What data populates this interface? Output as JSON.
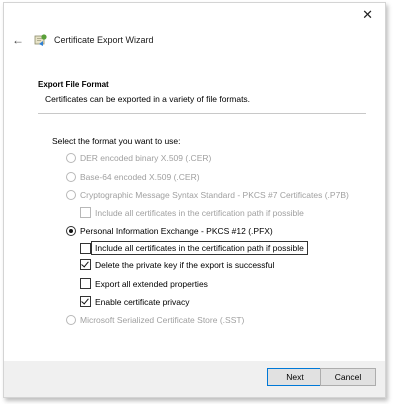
{
  "window": {
    "close_icon": "close-icon",
    "back_icon": "back-arrow-icon",
    "title_icon": "certificate-wizard-icon",
    "title": "Certificate Export Wizard"
  },
  "header": {
    "title": "Export File Format",
    "subtitle": "Certificates can be exported in a variety of file formats."
  },
  "prompt": "Select the format you want to use:",
  "formats": [
    {
      "label": "DER encoded binary X.509 (.CER)",
      "selected": false,
      "enabled": false
    },
    {
      "label": "Base-64 encoded X.509 (.CER)",
      "selected": false,
      "enabled": false
    },
    {
      "label": "Cryptographic Message Syntax Standard - PKCS #7 Certificates (.P7B)",
      "selected": false,
      "enabled": false
    },
    {
      "label": "Personal Information Exchange - PKCS #12 (.PFX)",
      "selected": true,
      "enabled": true
    },
    {
      "label": "Microsoft Serialized Certificate Store (.SST)",
      "selected": false,
      "enabled": false
    }
  ],
  "p7b_options": {
    "include_path": {
      "label": "Include all certificates in the certification path if possible",
      "checked": false,
      "enabled": false
    }
  },
  "pfx_options": {
    "include_path": {
      "label": "Include all certificates in the certification path if possible",
      "checked": false
    },
    "delete_key": {
      "label": "Delete the private key if the export is successful",
      "checked": true
    },
    "export_props": {
      "label": "Export all extended properties",
      "checked": false
    },
    "privacy": {
      "label": "Enable certificate privacy",
      "checked": true
    }
  },
  "buttons": {
    "next": "Next",
    "cancel": "Cancel"
  },
  "colors": {
    "accent": "#0078d7",
    "disabled_text": "#a0a0a0",
    "footer_bg": "#f0f0f0"
  }
}
